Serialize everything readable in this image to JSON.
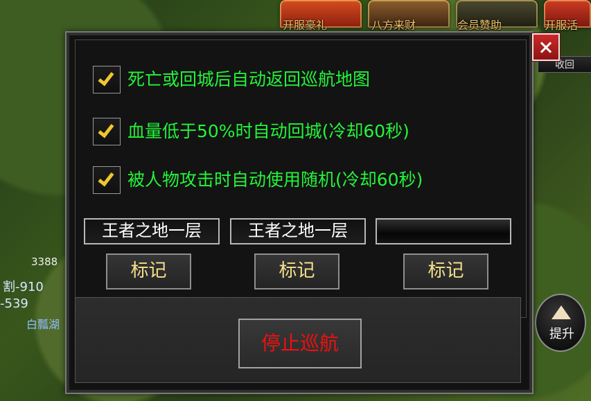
{
  "top_banner": {
    "labels": [
      "开服豪礼",
      "八方来财",
      "会员赞助",
      "开服活"
    ]
  },
  "left_hud": {
    "number": "3388",
    "negative_1": "割-910",
    "negative_2": "-539",
    "location": "白瓢湖"
  },
  "right_ui": {
    "tab_label": "收回",
    "upgrade_label": "提升"
  },
  "dialog": {
    "options": [
      {
        "label": "死亡或回城后自动返回巡航地图",
        "checked": true
      },
      {
        "label": "血量低于50%时自动回城(冷却60秒)",
        "checked": true
      },
      {
        "label": "被人物攻击时自动使用随机(冷却60秒)",
        "checked": true
      }
    ],
    "maps": [
      "王者之地一层",
      "王者之地一层",
      ""
    ],
    "mark_buttons": [
      "标记",
      "标记",
      "标记"
    ],
    "stop_button": "停止巡航"
  },
  "colors": {
    "option_text": "#24f43a",
    "mark_text": "#f6e18b",
    "stop_text": "#ef1010",
    "close_button": "#b11f1f"
  },
  "icons": {
    "close": "close-icon",
    "checkbox": "checkmark-icon",
    "upgrade": "arrow-up-icon"
  }
}
